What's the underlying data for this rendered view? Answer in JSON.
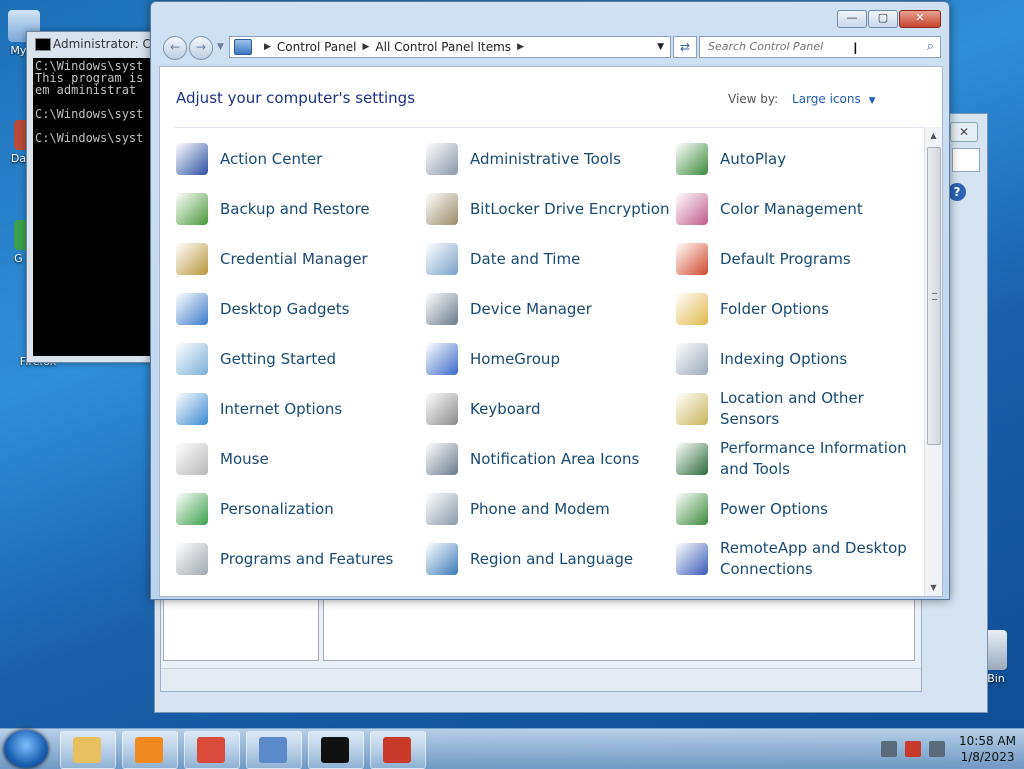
{
  "desktop": {
    "icons": [
      {
        "label": "My C"
      },
      {
        "label": "Data"
      },
      {
        "label": "G\nC"
      },
      {
        "label": "Firefox"
      },
      {
        "label": "Bin"
      }
    ]
  },
  "console": {
    "title": "Administrator: C:\\",
    "lines": "C:\\Windows\\syst\nThis program is\nem administrat\n\nC:\\Windows\\syst\n\nC:\\Windows\\syst"
  },
  "window": {
    "minimize": "—",
    "maximize": "▢",
    "close": "✕"
  },
  "nav": {
    "back": "←",
    "forward": "→",
    "breadcrumb": [
      "Control Panel",
      "All Control Panel Items"
    ],
    "refresh": "⇄",
    "search_placeholder": "Search Control Panel",
    "search_icon": "⌕"
  },
  "content": {
    "title": "Adjust your computer's settings",
    "view_by_label": "View by:",
    "view_by_value": "Large icons",
    "items": [
      {
        "label": "Action Center",
        "color": "#2a4fa0"
      },
      {
        "label": "Administrative Tools",
        "color": "#8a96a8"
      },
      {
        "label": "AutoPlay",
        "color": "#3b8a3a"
      },
      {
        "label": "Backup and Restore",
        "color": "#4a9a3a"
      },
      {
        "label": "BitLocker Drive Encryption",
        "color": "#9a8a6a"
      },
      {
        "label": "Color Management",
        "color": "#c05a8a"
      },
      {
        "label": "Credential Manager",
        "color": "#b8963a"
      },
      {
        "label": "Date and Time",
        "color": "#7aa0c8"
      },
      {
        "label": "Default Programs",
        "color": "#d04a2a"
      },
      {
        "label": "Desktop Gadgets",
        "color": "#3a7ac8"
      },
      {
        "label": "Device Manager",
        "color": "#6a7a8a"
      },
      {
        "label": "Folder Options",
        "color": "#e0b84a"
      },
      {
        "label": "Getting Started",
        "color": "#7ab0d8"
      },
      {
        "label": "HomeGroup",
        "color": "#3a6ac8"
      },
      {
        "label": "Indexing Options",
        "color": "#9aa8b8"
      },
      {
        "label": "Internet Options",
        "color": "#3a8ad0"
      },
      {
        "label": "Keyboard",
        "color": "#8a8a8a"
      },
      {
        "label": "Location and Other Sensors",
        "color": "#c8b45a"
      },
      {
        "label": "Mouse",
        "color": "#b8b8b8"
      },
      {
        "label": "Notification Area Icons",
        "color": "#6a7a8a"
      },
      {
        "label": "Performance Information and Tools",
        "color": "#2a6a3a"
      },
      {
        "label": "Personalization",
        "color": "#3aa04a"
      },
      {
        "label": "Phone and Modem",
        "color": "#8a9aaa"
      },
      {
        "label": "Power Options",
        "color": "#3a8a3a"
      },
      {
        "label": "Programs and Features",
        "color": "#a0a8b0"
      },
      {
        "label": "Region and Language",
        "color": "#3a7ab8"
      },
      {
        "label": "RemoteApp and Desktop Connections",
        "color": "#3a5ab8"
      }
    ]
  },
  "taskbar": {
    "apps": [
      {
        "name": "explorer",
        "color": "#e8c060"
      },
      {
        "name": "media-player",
        "color": "#f08a20"
      },
      {
        "name": "chrome",
        "color": "#d84a3a"
      },
      {
        "name": "control-panel",
        "color": "#5a8ac8"
      },
      {
        "name": "cmd",
        "color": "#111111"
      },
      {
        "name": "toolbox",
        "color": "#c83a2a"
      }
    ],
    "time": "10:58 AM",
    "date": "1/8/2023"
  }
}
